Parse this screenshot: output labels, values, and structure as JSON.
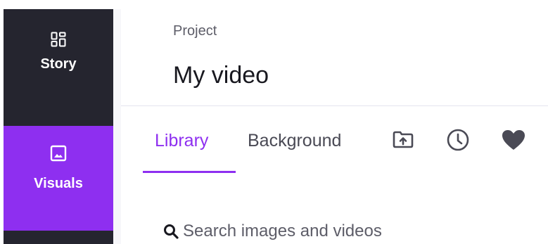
{
  "sidebar": {
    "items": [
      {
        "label": "Story",
        "icon": "grid-icon",
        "active": false
      },
      {
        "label": "Visuals",
        "icon": "image-icon",
        "active": true
      }
    ]
  },
  "header": {
    "project_label": "Project",
    "project_name": "My video"
  },
  "tabs": [
    {
      "label": "Library",
      "active": true
    },
    {
      "label": "Background",
      "active": false
    },
    {
      "icon": "folder-upload-icon"
    },
    {
      "icon": "clock-icon"
    },
    {
      "icon": "heart-icon"
    }
  ],
  "search": {
    "placeholder": "Search images and videos",
    "value": ""
  },
  "colors": {
    "accent": "#8e2ff0",
    "sidebar_bg": "#25252f"
  }
}
